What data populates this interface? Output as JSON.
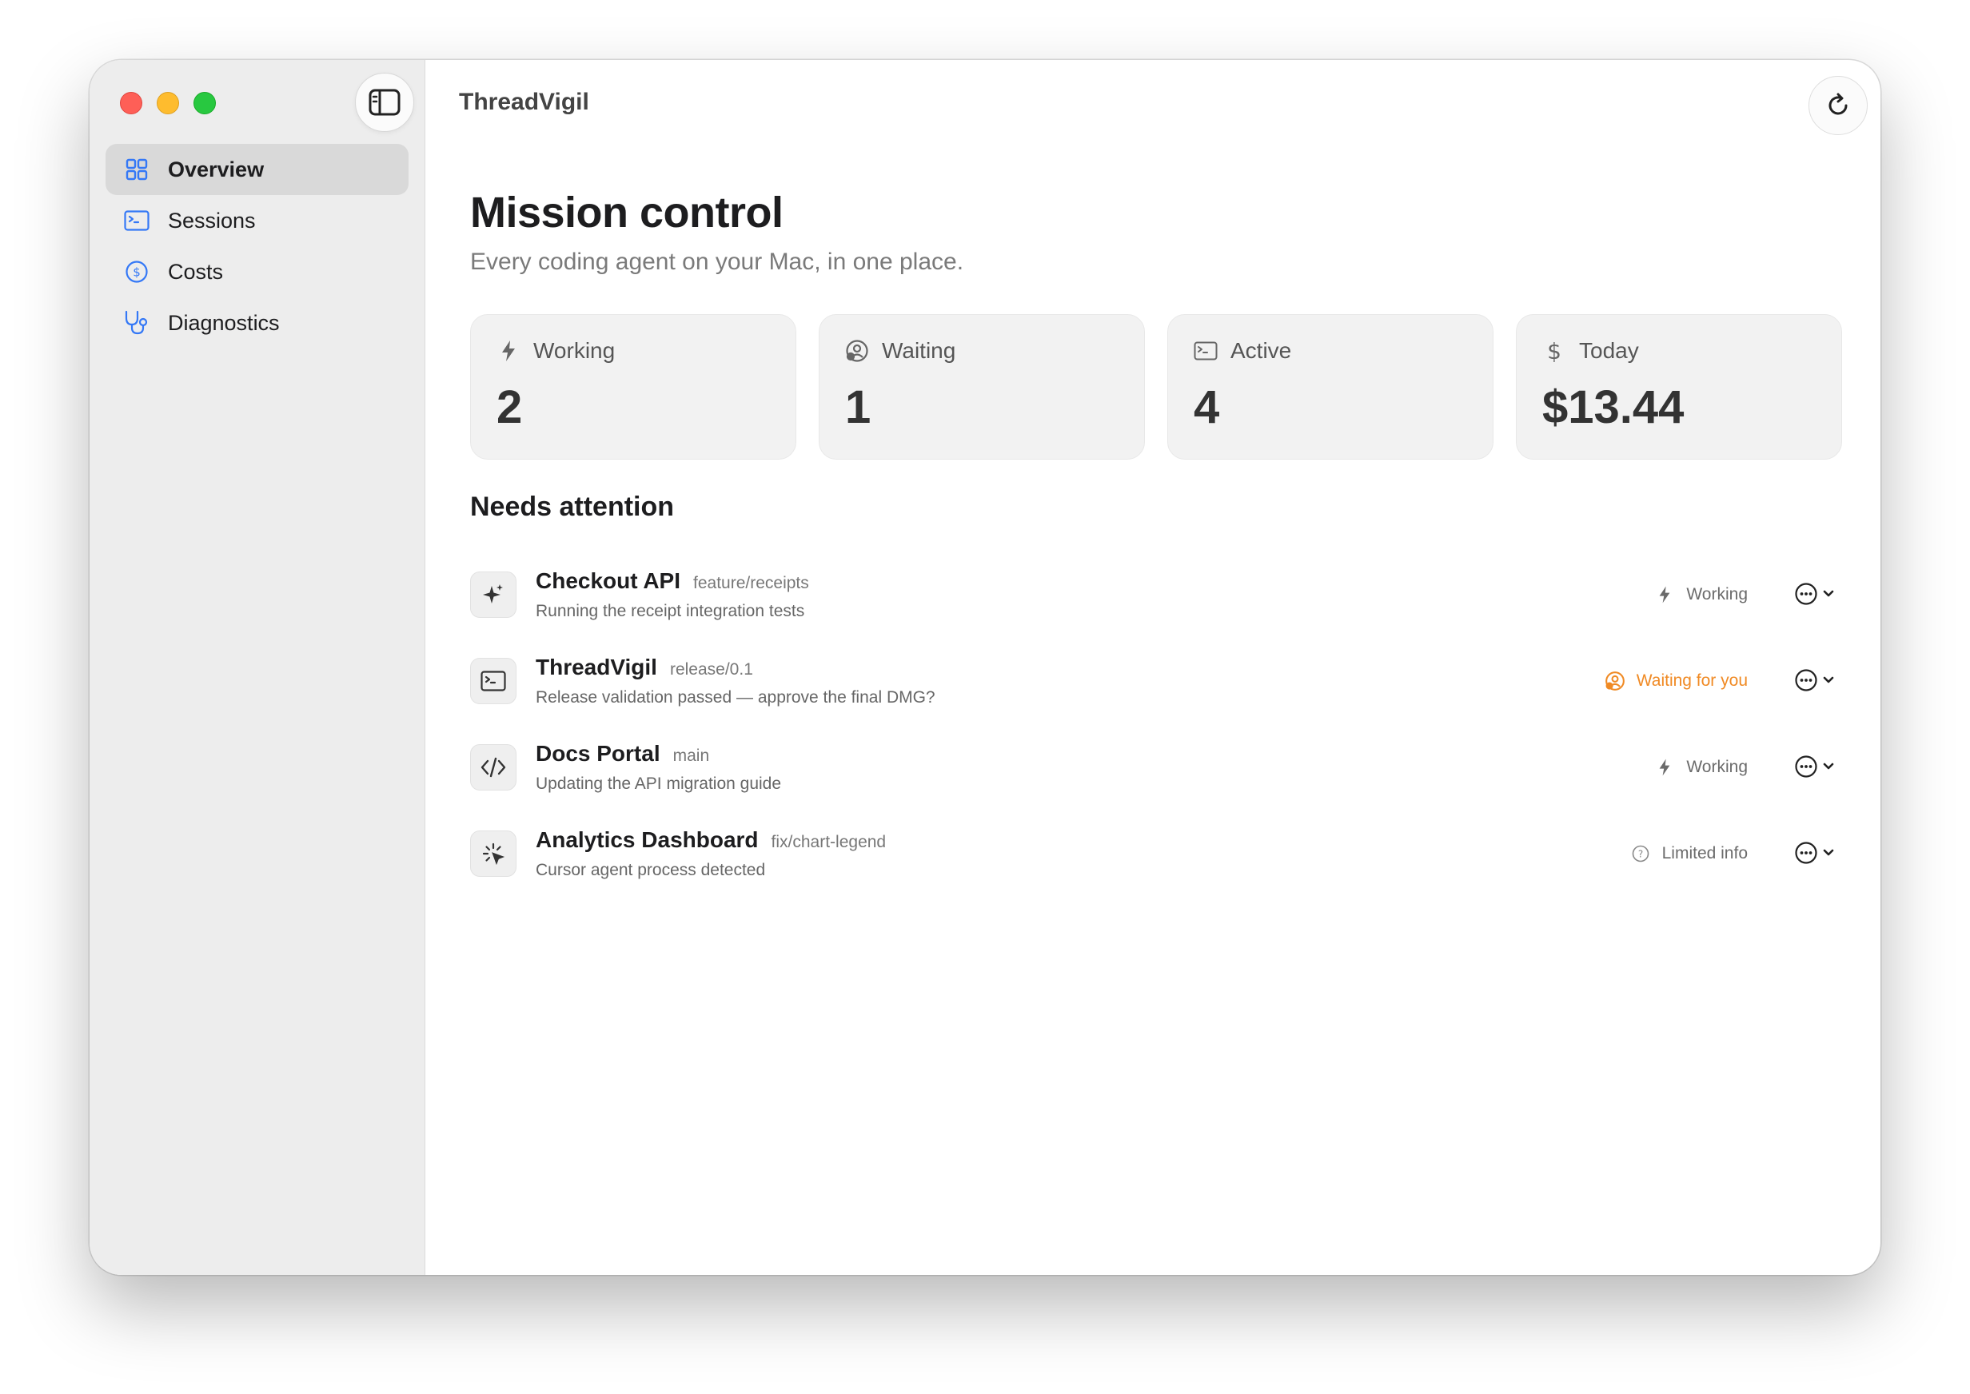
{
  "app": {
    "title": "ThreadVigil"
  },
  "sidebar": {
    "items": [
      {
        "label": "Overview",
        "icon": "grid-icon",
        "active": true
      },
      {
        "label": "Sessions",
        "icon": "terminal-icon"
      },
      {
        "label": "Costs",
        "icon": "dollar-circle-icon"
      },
      {
        "label": "Diagnostics",
        "icon": "stethoscope-icon"
      }
    ]
  },
  "header": {
    "title": "Mission control",
    "subtitle": "Every coding agent on your Mac, in one place."
  },
  "stats": [
    {
      "label": "Working",
      "value": "2",
      "icon": "bolt-icon"
    },
    {
      "label": "Waiting",
      "value": "1",
      "icon": "person-wait-icon"
    },
    {
      "label": "Active",
      "value": "4",
      "icon": "terminal-icon"
    },
    {
      "label": "Today",
      "value": "$13.44",
      "icon": "dollar-icon"
    }
  ],
  "attention": {
    "title": "Needs attention",
    "items": [
      {
        "name": "Checkout API",
        "branch": "feature/receipts",
        "desc": "Running the receipt integration tests",
        "status": "Working",
        "icon": "sparkle-icon"
      },
      {
        "name": "ThreadVigil",
        "branch": "release/0.1",
        "desc": "Release validation passed — approve the final DMG?",
        "status": "Waiting for you",
        "icon": "terminal-icon"
      },
      {
        "name": "Docs Portal",
        "branch": "main",
        "desc": "Updating the API migration guide",
        "status": "Working",
        "icon": "code-icon"
      },
      {
        "name": "Analytics Dashboard",
        "branch": "fix/chart-legend",
        "desc": "Cursor agent process detected",
        "status": "Limited info",
        "icon": "cursor-click-icon"
      }
    ]
  },
  "colors": {
    "accent": "#3478f6",
    "waiting": "#f08a24",
    "sidebar_bg": "#ededed"
  }
}
